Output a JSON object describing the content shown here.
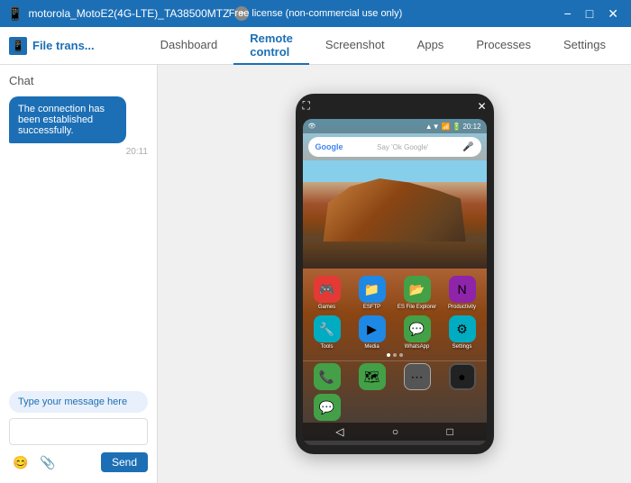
{
  "titleBar": {
    "title": "motorola_MotoE2(4G-LTE)_TA38500MTZ",
    "license": "Free license (non-commercial use only)",
    "controls": [
      "minimize",
      "maximize",
      "close"
    ]
  },
  "nav": {
    "logo": "File trans...",
    "tabs": [
      {
        "label": "Dashboard",
        "active": false
      },
      {
        "label": "Remote control",
        "active": true
      },
      {
        "label": "Screenshot",
        "active": false
      },
      {
        "label": "Apps",
        "active": false
      },
      {
        "label": "Processes",
        "active": false
      },
      {
        "label": "Settings",
        "active": false
      }
    ]
  },
  "chat": {
    "label": "Chat",
    "message": "The connection has been established successfully.",
    "time": "20:11",
    "inputPlaceholder": "Type your message here",
    "sendButton": "Send"
  },
  "phone": {
    "time": "20:12",
    "googlePlaceholder": "Say 'Ok Google'",
    "apps": [
      {
        "label": "Games",
        "color": "#e53935",
        "icon": "🎮"
      },
      {
        "label": "ESFTP",
        "color": "#1e88e5",
        "icon": "📁"
      },
      {
        "label": "ES File Explorer",
        "color": "#43a047",
        "icon": "📂"
      },
      {
        "label": "Productivity",
        "color": "#8e24aa",
        "icon": "📊"
      },
      {
        "label": "Tools",
        "color": "#00acc1",
        "icon": "🔧"
      },
      {
        "label": "Media",
        "color": "#1e88e5",
        "icon": "▶"
      },
      {
        "label": "WhatsApp",
        "color": "#43a047",
        "icon": "💬"
      },
      {
        "label": "Settings",
        "color": "#00acc1",
        "icon": "⚙"
      }
    ],
    "dock": [
      {
        "label": "Phone",
        "color": "#43a047",
        "icon": "📞"
      },
      {
        "label": "Maps",
        "color": "#43a047",
        "icon": "🗺"
      },
      {
        "label": "Apps",
        "color": "#555",
        "icon": "⋯"
      },
      {
        "label": "Camera",
        "color": "#222",
        "icon": "●"
      },
      {
        "label": "Messages",
        "color": "#43a047",
        "icon": "💬"
      }
    ]
  }
}
